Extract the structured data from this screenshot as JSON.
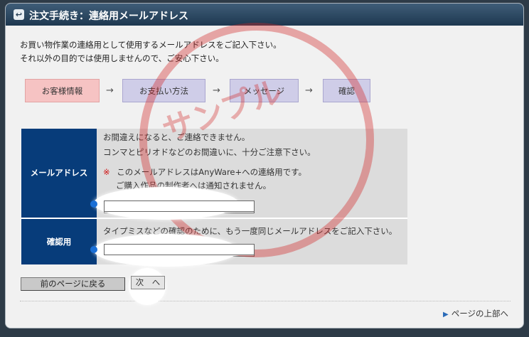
{
  "window": {
    "title": "注文手続き：連絡用メールアドレス",
    "icon": "return-icon"
  },
  "intro": {
    "line1": "お買い物作業の連絡用として使用するメールアドレスをご記入下さい。",
    "line2": "それ以外の目的では使用しませんので、ご安心下さい。"
  },
  "steps": [
    {
      "label": "お客様情報",
      "state": "current"
    },
    {
      "label": "お支払い方法",
      "state": "pending"
    },
    {
      "label": "メッセージ",
      "state": "pending"
    },
    {
      "label": "確認",
      "state": "pending"
    }
  ],
  "step_arrow": "→",
  "email": {
    "label": "メールアドレス",
    "note1": "お間違えになると、ご連絡できません。",
    "note2": "コンマとピリオドなどのお間違いに、十分ご注意下さい。",
    "note3_mark": "※",
    "note3_text": "このメールアドレスはAnyWare+への連絡用です。",
    "note4": "ご購入作品の制作者へは通知されません。",
    "value": ""
  },
  "confirm": {
    "label": "確認用",
    "note": "タイプミスなどの確認のために、もう一度同じメールアドレスをご記入下さい。",
    "value": ""
  },
  "buttons": {
    "back": "前のページに戻る",
    "next": "次　へ"
  },
  "page_top_link": "ページの上部へ",
  "stamp_text": "サンプル",
  "colors": {
    "title_bar": "#1e3850",
    "label_bg": "#073c7a",
    "step_current": "#f6c3c3",
    "step_pending": "#cfcde8",
    "stamp": "#d22828",
    "warning": "#d01010"
  }
}
